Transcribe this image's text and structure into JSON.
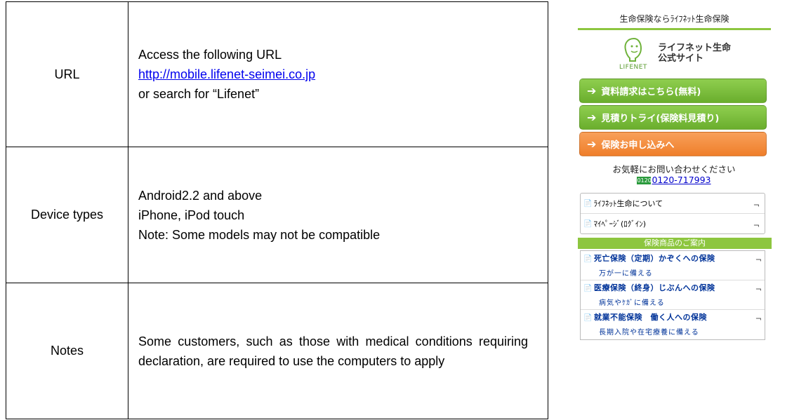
{
  "table": {
    "rows": [
      {
        "label": "URL",
        "lines": [
          "Access the following URL",
          "http://mobile.lifenet-seimei.co.jp",
          "or search for “Lifenet”"
        ]
      },
      {
        "label": "Device types",
        "lines": [
          "Android2.2 and above",
          "iPhone, iPod touch",
          "Note: Some models may not be compatible"
        ]
      },
      {
        "label": "Notes",
        "text": "Some customers, such as those with medical conditions requiring declaration, are required to use the computers to apply"
      }
    ]
  },
  "mobile": {
    "tagline": "生命保険ならﾗｲﾌﾈｯﾄ生命保険",
    "logo": {
      "line1": "ライフネット生命",
      "line2": "公式サイト",
      "wordmark": "LIFENET"
    },
    "buttons": [
      {
        "label": "資料請求はこちら(無料)",
        "color": "#7bbf3b"
      },
      {
        "label": "見積りトライ(保険料見積り)",
        "color": "#7bbf3b"
      },
      {
        "label": "保険お申し込みへ",
        "color": "#f28c3c"
      }
    ],
    "contact": {
      "text": "お気軽にお問い合わせください",
      "free_badge": "0120",
      "phone": "0120-717993"
    },
    "links": [
      {
        "label": "ﾗｲﾌﾈｯﾄ生命について"
      },
      {
        "label": "ﾏｲﾍﾟｰｼﾞ(ﾛｸﾞｲﾝ)"
      }
    ],
    "section_title": "保険商品のご案内",
    "products": [
      {
        "title": "死亡保険（定期）かぞくへの保険",
        "sub": "万が一に備える"
      },
      {
        "title": "医療保険（終身）じぶんへの保険",
        "sub": "病気やｹｶﾞに備える"
      },
      {
        "title": "就業不能保険　働く人への保険",
        "sub": "長期入院や在宅療養に備える"
      }
    ],
    "accent_green": "#8dc63f",
    "accent_orange": "#f28c3c"
  }
}
